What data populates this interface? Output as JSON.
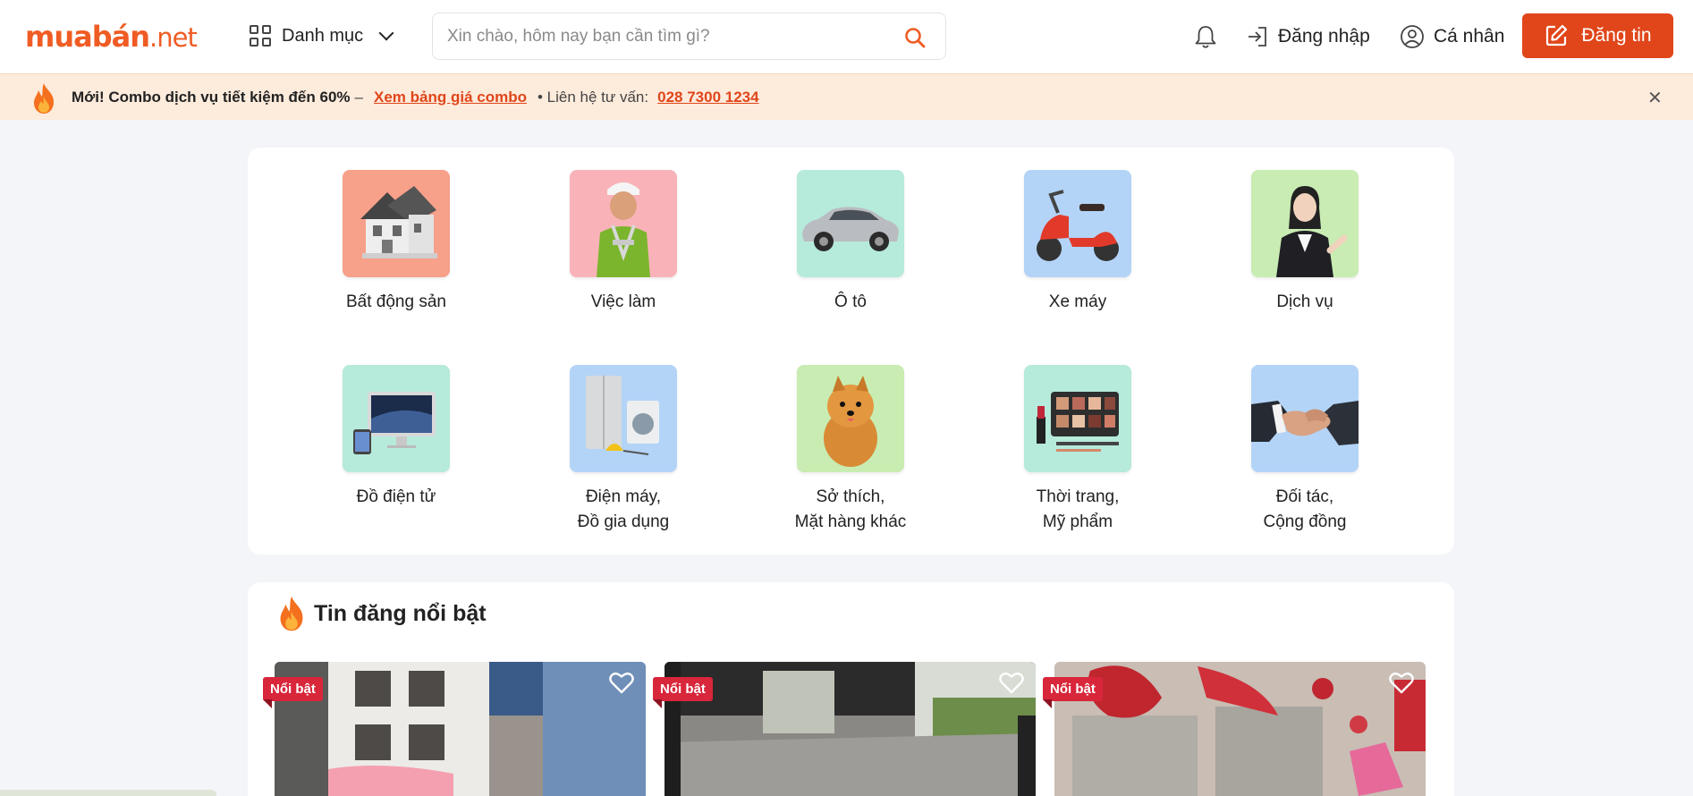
{
  "header": {
    "logo_main": "muabán",
    "logo_tld": ".net",
    "category_label": "Danh mục",
    "search_placeholder": "Xin chào, hôm nay bạn cần tìm gì?",
    "login_label": "Đăng nhập",
    "profile_label": "Cá nhân",
    "post_label": "Đăng tin"
  },
  "promo": {
    "headline": "Mới! Combo dịch vụ tiết kiệm đến 60%",
    "separator": "–",
    "link": "Xem bảng giá combo",
    "contact_label": "• Liên hệ tư vấn:",
    "phone": "028 7300 1234",
    "close": "✕"
  },
  "categories": [
    {
      "label": "Bất động sản",
      "bg": "#f7a08a"
    },
    {
      "label": "Việc làm",
      "bg": "#f9b3b8"
    },
    {
      "label": "Ô tô",
      "bg": "#b6eadb"
    },
    {
      "label": "Xe máy",
      "bg": "#b3d4f7"
    },
    {
      "label": "Dịch vụ",
      "bg": "#c8ecb2"
    },
    {
      "label": "Đồ điện tử",
      "bg": "#b6eadb"
    },
    {
      "label": "Điện máy,\nĐồ gia dụng",
      "bg": "#b3d4f7"
    },
    {
      "label": "Sở thích,\nMặt hàng khác",
      "bg": "#c8ecb2"
    },
    {
      "label": "Thời trang,\nMỹ phẩm",
      "bg": "#b6eadb"
    },
    {
      "label": "Đối tác,\nCộng đồng",
      "bg": "#b3d4f7"
    }
  ],
  "featured": {
    "title": "Tin đăng nổi bật",
    "badge": "Nổi bật",
    "listings_count_visible": 3
  },
  "colors": {
    "brand": "#ef5c24",
    "button": "#e0461a",
    "badge": "#d8263a",
    "promo_bg": "#fdebdc"
  }
}
